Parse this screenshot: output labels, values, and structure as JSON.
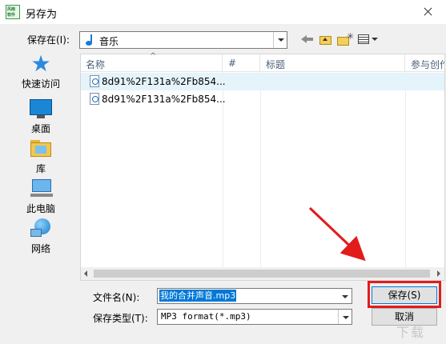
{
  "window": {
    "title": "另存为",
    "app_icon_lines": [
      "风雨",
      "软件"
    ]
  },
  "toolbar": {
    "save_in_label": "保存在(I):",
    "save_in_value": "音乐"
  },
  "places": [
    {
      "label": "快速访问",
      "icon": "quick-access-star-icon"
    },
    {
      "label": "桌面",
      "icon": "desktop-icon"
    },
    {
      "label": "库",
      "icon": "library-icon"
    },
    {
      "label": "此电脑",
      "icon": "this-pc-icon"
    },
    {
      "label": "网络",
      "icon": "network-icon"
    }
  ],
  "filelist": {
    "columns": [
      "名称",
      "#",
      "标题",
      "参与创作"
    ],
    "sort_indicator": "^",
    "rows": [
      {
        "name": "8d91%2F131a%2Fb854...",
        "selected": true
      },
      {
        "name": "8d91%2F131a%2Fb854...",
        "selected": false
      }
    ]
  },
  "form": {
    "filename_label": "文件名(N):",
    "filename_value": "我的合并声音.mp3",
    "filetype_label": "保存类型(T):",
    "filetype_value": "MP3 format(*.mp3)"
  },
  "buttons": {
    "save": "保存(S)",
    "cancel": "取消"
  },
  "watermark": "下载",
  "colors": {
    "accent": "#0078d7",
    "annotation_red": "#e21b1b",
    "selection": "#e5f3fb"
  }
}
